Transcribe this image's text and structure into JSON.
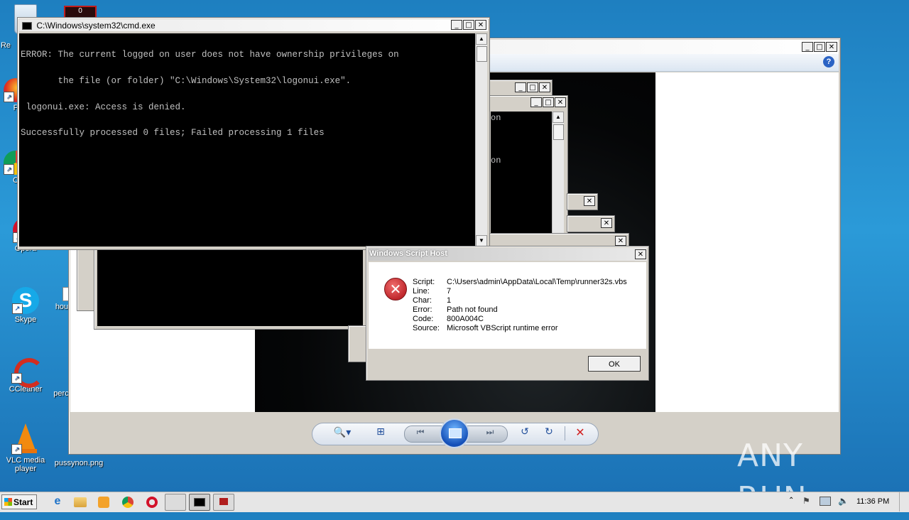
{
  "desktop": {
    "icons": [
      {
        "label": "Re"
      },
      {
        "label": "F"
      },
      {
        "label": "C"
      },
      {
        "label": "Opera"
      },
      {
        "label": "fie"
      },
      {
        "label": "Skype"
      },
      {
        "label": "hou"
      },
      {
        "label": "CCleaner"
      },
      {
        "label": "perc"
      },
      {
        "label": "VLC media player"
      },
      {
        "label": "pussynon.png"
      }
    ],
    "top_badge": "0"
  },
  "cmd": {
    "title": "C:\\Windows\\system32\\cmd.exe",
    "lines": [
      "ERROR: The current logged on user does not have ownership privileges on",
      "       the file (or folder) \"C:\\Windows\\System32\\logonui.exe\".",
      " logonui.exe: Access is denied.",
      "Successfully processed 0 files; Failed processing 1 files"
    ]
  },
  "background_fragments": {
    "frag1": "on",
    "frag2": "on"
  },
  "dialog": {
    "title": "Windows Script Host",
    "rows": [
      {
        "key": "Script:",
        "value": "C:\\Users\\admin\\AppData\\Local\\Temp\\runner32s.vbs"
      },
      {
        "key": "Line:",
        "value": "7"
      },
      {
        "key": "Char:",
        "value": "1"
      },
      {
        "key": "Error:",
        "value": "Path not found"
      },
      {
        "key": "Code:",
        "value": "800A004C"
      },
      {
        "key": "Source:",
        "value": "Microsoft VBScript runtime error"
      }
    ],
    "ok_label": "OK"
  },
  "watermark": {
    "text": "ANY RUN"
  },
  "taskbar": {
    "start_label": "Start",
    "clock": "11:36 PM"
  },
  "colors": {
    "dialog_error_icon": "#c0282d",
    "watermark": "#ffffff"
  }
}
